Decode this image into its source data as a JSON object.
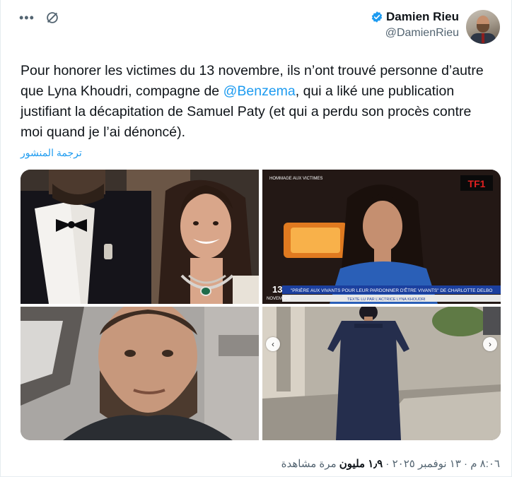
{
  "author": {
    "display_name": "Damien Rieu",
    "handle": "@DamienRieu"
  },
  "tweet": {
    "text_part1": "Pour honorer les victimes du 13 novembre, ils n’ont trouvé personne d’autre que Lyna Khoudri, compagne de ",
    "mention": "@Benzema",
    "text_part2": ", qui a liké une publication justifiant la décapitation de Samuel Paty (et qui a perdu son procès contre moi quand je l’ai dénoncé).",
    "translate_label": "ترجمة المنشور"
  },
  "media": {
    "tv_banner_left": "HOMMAGE AUX VICTIMES",
    "tv_caption": "\"PRIÈRE AUX VIVANTS POUR LEUR PARDONNER D'ÊTRE VIVANTS\" DE CHARLOTTE DELBO",
    "tv_subcaption": "TEXTE LU PAR L'ACTRICE LYNA KHOUDRI",
    "tv_channel": "TF1",
    "tv_date_num": "13",
    "tv_date_word": "NOVEMBRE"
  },
  "meta": {
    "time": "٨:٠٦ م",
    "date": "١٣ نوفمبر ٢٠٢٥",
    "views_count": "١٫٩ مليون",
    "views_label": "مرة مشاهدة"
  },
  "colors": {
    "accent": "#1d9bf0",
    "secondary_text": "#536471"
  }
}
